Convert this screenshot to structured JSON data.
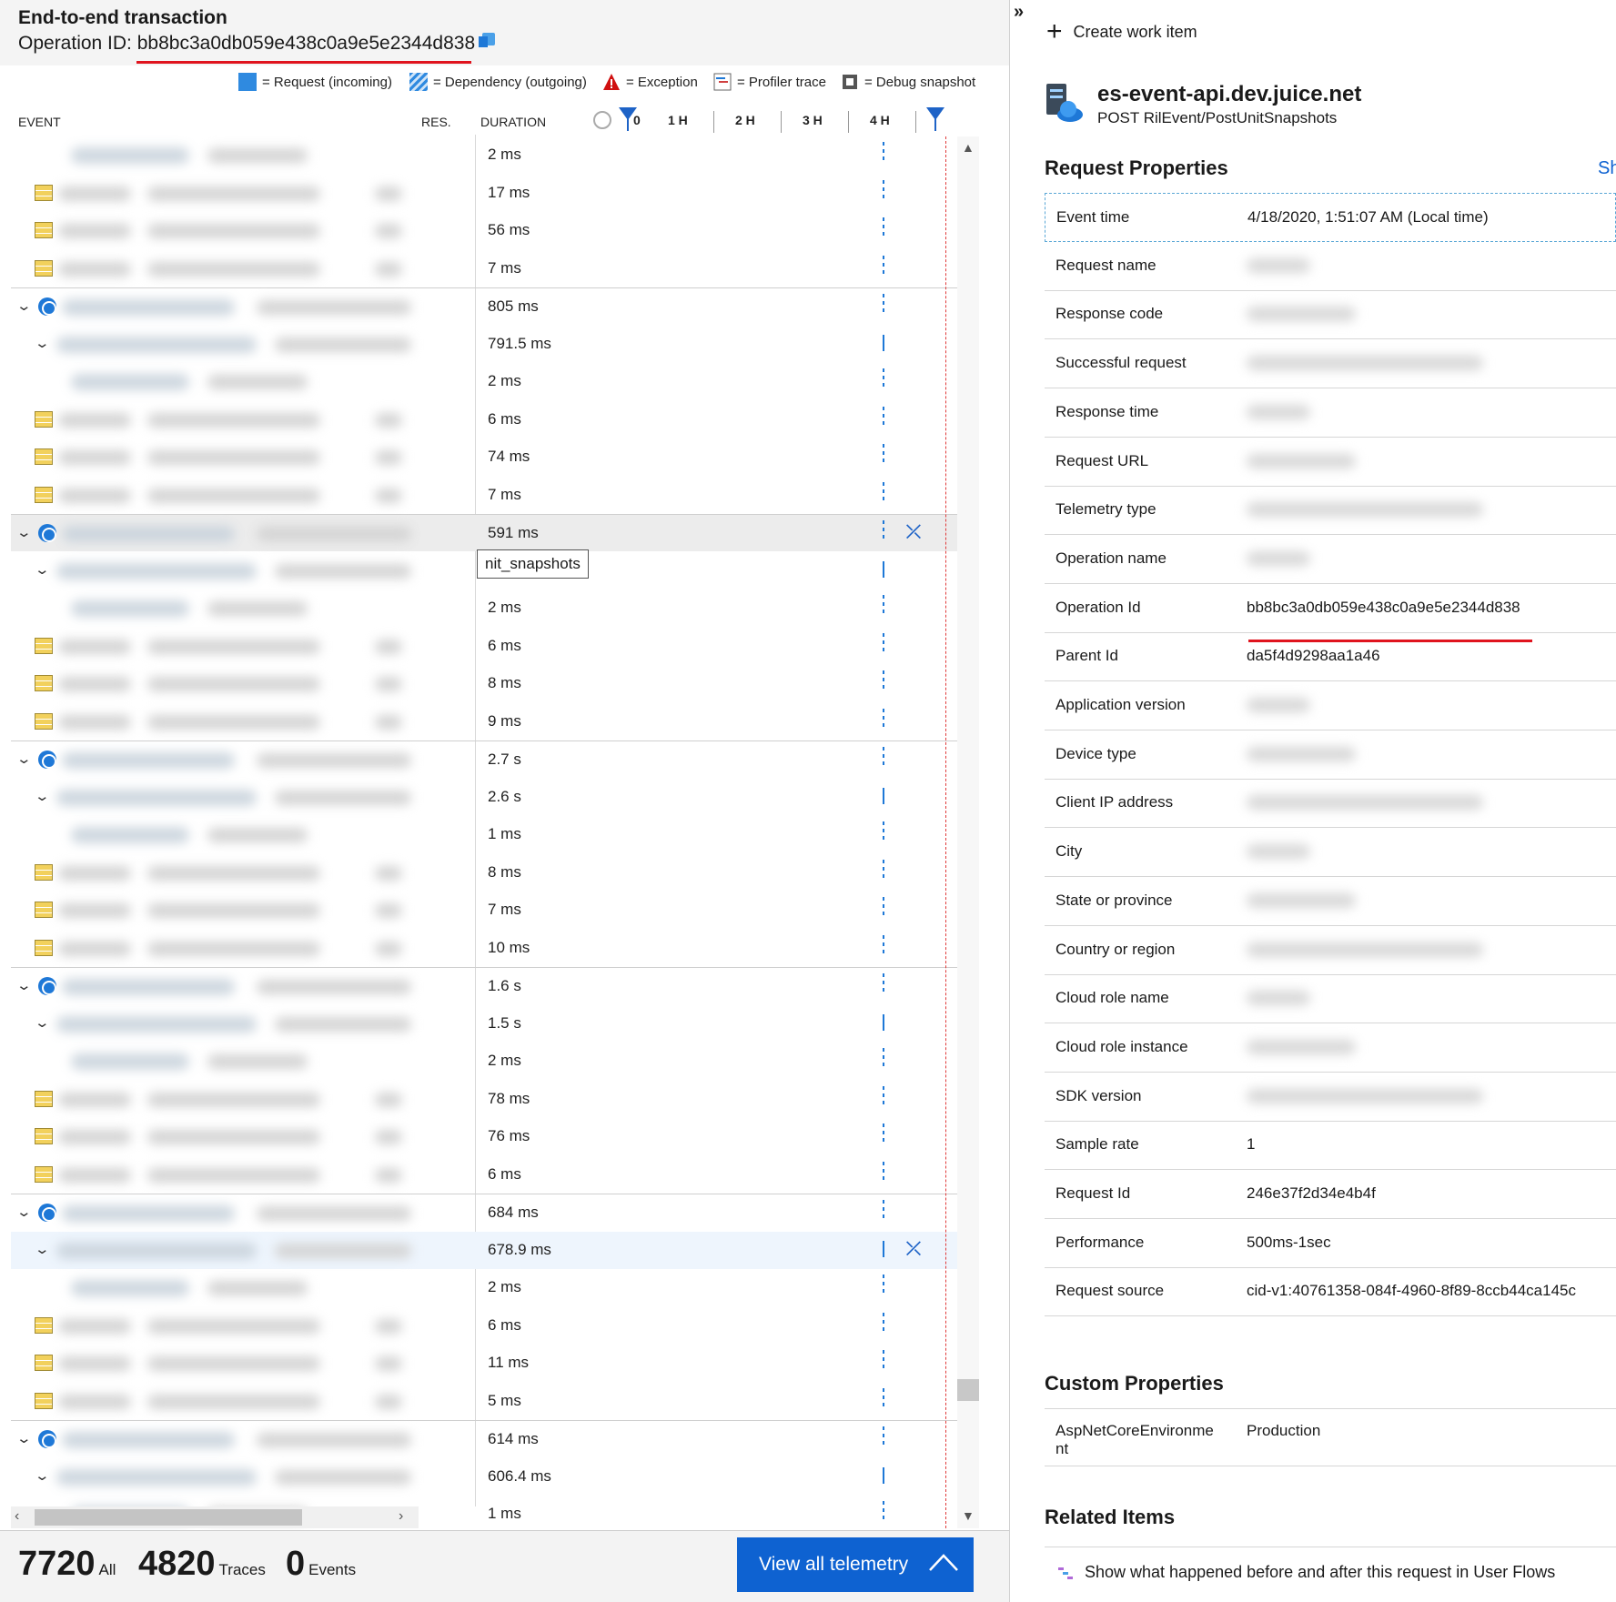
{
  "header": {
    "title": "End-to-end transaction",
    "operation_label": "Operation ID:",
    "operation_id": "bb8bc3a0db059e438c0a9e5e2344d838"
  },
  "legend": [
    {
      "icon": "request-swatch",
      "label": "= Request (incoming)"
    },
    {
      "icon": "dependency-swatch",
      "label": "= Dependency (outgoing)"
    },
    {
      "icon": "exception-icon",
      "label": "= Exception"
    },
    {
      "icon": "profiler-icon",
      "label": "= Profiler trace"
    },
    {
      "icon": "debug-icon",
      "label": "= Debug snapshot"
    }
  ],
  "columns": {
    "event": "EVENT",
    "res": "RES.",
    "duration": "DURATION"
  },
  "timeline": [
    "0",
    "1 H",
    "2 H",
    "3 H",
    "4 H"
  ],
  "rows": [
    {
      "type": "leaf",
      "duration": "2 ms"
    },
    {
      "type": "table",
      "duration": "17 ms"
    },
    {
      "type": "table",
      "duration": "56 ms"
    },
    {
      "type": "table",
      "duration": "7 ms"
    },
    {
      "type": "group",
      "duration": "805 ms"
    },
    {
      "type": "child",
      "duration": "791.5 ms"
    },
    {
      "type": "leaf",
      "duration": "2 ms"
    },
    {
      "type": "table",
      "duration": "6 ms"
    },
    {
      "type": "table",
      "duration": "74 ms"
    },
    {
      "type": "table",
      "duration": "7 ms"
    },
    {
      "type": "group",
      "duration": "591 ms",
      "highlight": true,
      "compress": true
    },
    {
      "type": "child",
      "duration": "",
      "tooltip": "nit_snapshots"
    },
    {
      "type": "leaf",
      "duration": "2 ms"
    },
    {
      "type": "table",
      "duration": "6 ms"
    },
    {
      "type": "table",
      "duration": "8 ms"
    },
    {
      "type": "table",
      "duration": "9 ms"
    },
    {
      "type": "group",
      "duration": "2.7 s"
    },
    {
      "type": "child",
      "duration": "2.6 s"
    },
    {
      "type": "leaf",
      "duration": "1 ms"
    },
    {
      "type": "table",
      "duration": "8 ms"
    },
    {
      "type": "table",
      "duration": "7 ms"
    },
    {
      "type": "table",
      "duration": "10 ms"
    },
    {
      "type": "group",
      "duration": "1.6 s"
    },
    {
      "type": "child",
      "duration": "1.5 s"
    },
    {
      "type": "leaf",
      "duration": "2 ms"
    },
    {
      "type": "table",
      "duration": "78 ms"
    },
    {
      "type": "table",
      "duration": "76 ms"
    },
    {
      "type": "table",
      "duration": "6 ms"
    },
    {
      "type": "group",
      "duration": "684 ms"
    },
    {
      "type": "child",
      "duration": "678.9 ms",
      "selected": true,
      "compress": true
    },
    {
      "type": "leaf",
      "duration": "2 ms"
    },
    {
      "type": "table",
      "duration": "6 ms"
    },
    {
      "type": "table",
      "duration": "11 ms"
    },
    {
      "type": "table",
      "duration": "5 ms"
    },
    {
      "type": "group",
      "duration": "614 ms"
    },
    {
      "type": "child",
      "duration": "606.4 ms"
    },
    {
      "type": "leaf",
      "duration": "1 ms"
    }
  ],
  "counts": [
    {
      "value": "7720",
      "label": "All"
    },
    {
      "value": "4820",
      "label": "Traces"
    },
    {
      "value": "0",
      "label": "Events"
    }
  ],
  "view_all_label": "View all telemetry",
  "right": {
    "create_work_item": "Create work item",
    "service_name": "es-event-api.dev.juice.net",
    "service_sub": "POST RilEvent/PostUnitSnapshots",
    "request_properties_title": "Request Properties",
    "show_link": "Sh",
    "properties": [
      {
        "key": "Event time",
        "value": "4/18/2020, 1:51:07 AM (Local time)"
      },
      {
        "key": "Request name",
        "value": ""
      },
      {
        "key": "Response code",
        "value": ""
      },
      {
        "key": "Successful request",
        "value": ""
      },
      {
        "key": "Response time",
        "value": ""
      },
      {
        "key": "Request URL",
        "value": ""
      },
      {
        "key": "Telemetry type",
        "value": ""
      },
      {
        "key": "Operation name",
        "value": ""
      },
      {
        "key": "Operation Id",
        "value": "bb8bc3a0db059e438c0a9e5e2344d838"
      },
      {
        "key": "Parent Id",
        "value": "da5f4d9298aa1a46"
      },
      {
        "key": "Application version",
        "value": ""
      },
      {
        "key": "Device type",
        "value": ""
      },
      {
        "key": "Client IP address",
        "value": ""
      },
      {
        "key": "City",
        "value": ""
      },
      {
        "key": "State or province",
        "value": ""
      },
      {
        "key": "Country or region",
        "value": ""
      },
      {
        "key": "Cloud role name",
        "value": ""
      },
      {
        "key": "Cloud role instance",
        "value": ""
      },
      {
        "key": "SDK version",
        "value": ""
      },
      {
        "key": "Sample rate",
        "value": "1"
      },
      {
        "key": "Request Id",
        "value": "246e37f2d34e4b4f"
      },
      {
        "key": "Performance",
        "value": "500ms-1sec"
      },
      {
        "key": "Request source",
        "value": "cid-v1:40761358-084f-4960-8f89-8ccb44ca145c"
      }
    ],
    "custom_properties_title": "Custom Properties",
    "custom_key": "AspNetCoreEnvironme nt",
    "custom_value": "Production",
    "related_items_title": "Related Items",
    "related_item": "Show what happened before and after this request in User Flows"
  },
  "colors": {
    "accent": "#0e62d1",
    "highlight_red": "#e0141e"
  }
}
